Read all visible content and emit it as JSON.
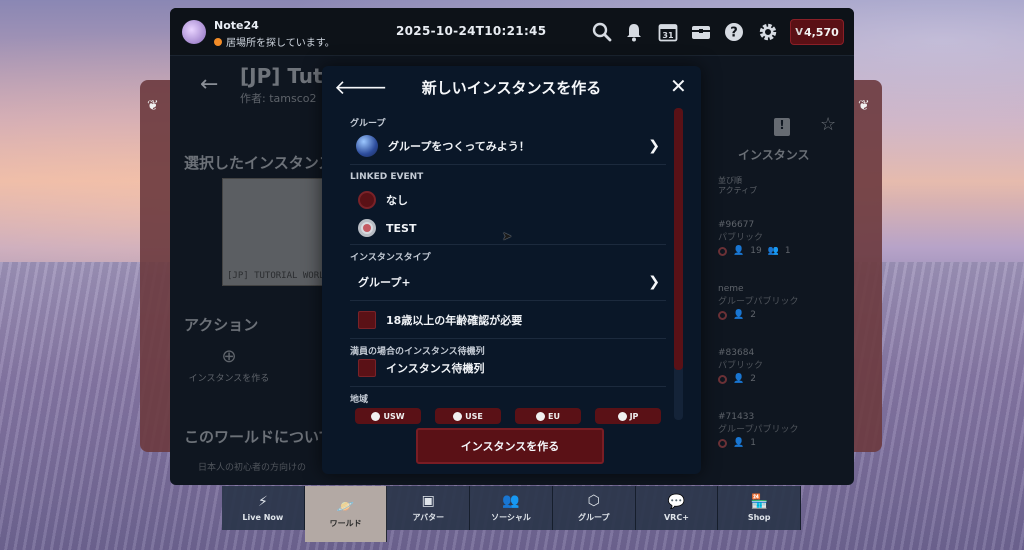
{
  "topbar": {
    "user_name": "Note24",
    "user_status": "居場所を探しています。",
    "clock": "2025-10-24T10:21:45",
    "currency_symbol": "V",
    "currency_amount": "4,570",
    "icons": [
      "search-icon",
      "bell-icon",
      "calendar-icon",
      "inventory-icon",
      "help-icon",
      "gear-icon"
    ],
    "calendar_day": "31"
  },
  "behind": {
    "world_title": "[JP] Tutorial World",
    "world_author": "作者: tamsco2",
    "selected_instance_heading": "選択したインスタンス",
    "thumb_text": "[JP] TUTORIAL WORLD",
    "actions_heading": "アクション",
    "create_instance_tile": "インスタンスを作る",
    "about_heading": "このワールドについて",
    "about_text": "日本人の初心者の方向けの",
    "instances_heading": "インスタンス",
    "sort_label": "並び順",
    "sort_value": "アクティブ",
    "instances": [
      {
        "id": "#96677",
        "type": "パブリック",
        "users": "19",
        "friends": "1"
      },
      {
        "id": "neme",
        "type": "グループパブリック",
        "users": "2",
        "friends": ""
      },
      {
        "id": "#83684",
        "type": "パブリック",
        "users": "2",
        "friends": ""
      },
      {
        "id": "#71433",
        "type": "グループパブリック",
        "users": "1",
        "friends": ""
      }
    ]
  },
  "modal": {
    "title": "新しいインスタンスを作る",
    "group_label": "グループ",
    "group_value": "グループをつくってみよう！",
    "linked_event_label": "LINKED EVENT",
    "event_none": "なし",
    "event_test": "TEST",
    "instance_type_label": "インスタンスタイプ",
    "instance_type_value": "グループ+",
    "age_verification": "18歳以上の年齢確認が必要",
    "queue_label": "満員の場合のインスタンス待機列",
    "queue_option": "インスタンス待機列",
    "region_label": "地域",
    "regions": [
      "USW",
      "USE",
      "EU",
      "JP"
    ],
    "create_button": "インスタンスを作る"
  },
  "nav": {
    "items": [
      {
        "label": "Live Now",
        "icon": "lightning-icon"
      },
      {
        "label": "ワールド",
        "icon": "planet-icon"
      },
      {
        "label": "アバター",
        "icon": "avatar-icon"
      },
      {
        "label": "ソーシャル",
        "icon": "social-icon"
      },
      {
        "label": "グループ",
        "icon": "group-icon"
      },
      {
        "label": "VRC+",
        "icon": "vrcplus-icon"
      },
      {
        "label": "Shop",
        "icon": "shop-icon"
      }
    ],
    "active_index": 1
  },
  "colors": {
    "accent_red": "#5a1116",
    "modal_bg": "#0a1728",
    "window_bg": "#0f1620"
  }
}
